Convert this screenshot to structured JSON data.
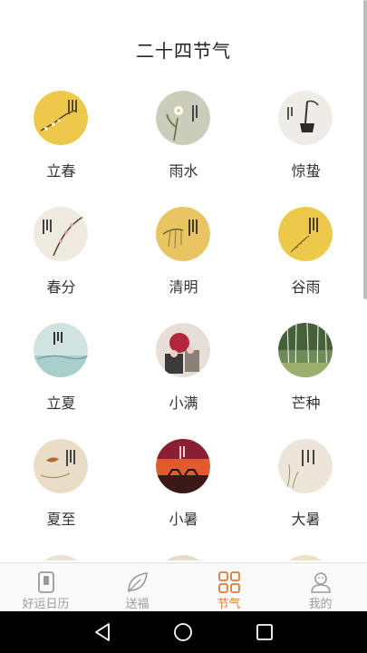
{
  "header": {
    "title": "二十四节气"
  },
  "terms": [
    {
      "label": "立春",
      "icon": "plum-blossom-yellow-image"
    },
    {
      "label": "雨水",
      "icon": "white-flower-green-image"
    },
    {
      "label": "惊蛰",
      "icon": "ink-teapot-image"
    },
    {
      "label": "春分",
      "icon": "cherry-branch-image"
    },
    {
      "label": "清明",
      "icon": "willow-yellow-image"
    },
    {
      "label": "谷雨",
      "icon": "grain-yellow-image"
    },
    {
      "label": "立夏",
      "icon": "lake-landscape-image"
    },
    {
      "label": "小满",
      "icon": "people-painting-image"
    },
    {
      "label": "芒种",
      "icon": "forest-green-image"
    },
    {
      "label": "夏至",
      "icon": "fish-beige-image"
    },
    {
      "label": "小暑",
      "icon": "sunset-horses-image"
    },
    {
      "label": "大暑",
      "icon": "grass-beige-image"
    }
  ],
  "tabs": [
    {
      "label": "好运日历",
      "icon": "calendar-icon",
      "active": false
    },
    {
      "label": "送福",
      "icon": "leaf-icon",
      "active": false
    },
    {
      "label": "节气",
      "icon": "grid-icon",
      "active": true
    },
    {
      "label": "我的",
      "icon": "user-icon",
      "active": false
    }
  ],
  "colors": {
    "accent": "#e07a32",
    "inactive": "#9a9a9a",
    "title": "#222222"
  }
}
